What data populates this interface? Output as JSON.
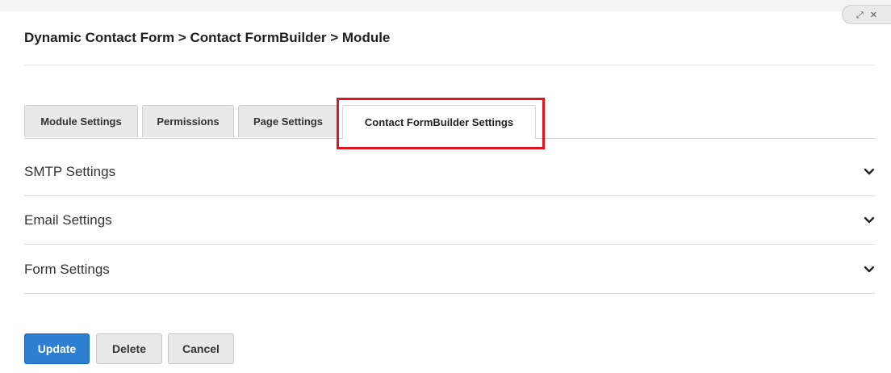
{
  "breadcrumb": "Dynamic Contact Form > Contact FormBuilder > Module",
  "window_controls": {
    "maximize_glyph": "⤢",
    "close_glyph": "✕"
  },
  "tabs": [
    {
      "label": "Module Settings",
      "active": false
    },
    {
      "label": "Permissions",
      "active": false
    },
    {
      "label": "Page Settings",
      "active": false
    },
    {
      "label": "Contact FormBuilder Settings",
      "active": true
    }
  ],
  "sections": [
    {
      "label": "SMTP Settings",
      "icon": "chevron-down-icon"
    },
    {
      "label": "Email Settings",
      "icon": "chevron-down-icon"
    },
    {
      "label": "Form Settings",
      "icon": "chevron-down-icon"
    }
  ],
  "buttons": {
    "update": "Update",
    "delete": "Delete",
    "cancel": "Cancel"
  },
  "colors": {
    "primary": "#2d7fd3",
    "highlight": "#e0141e"
  }
}
